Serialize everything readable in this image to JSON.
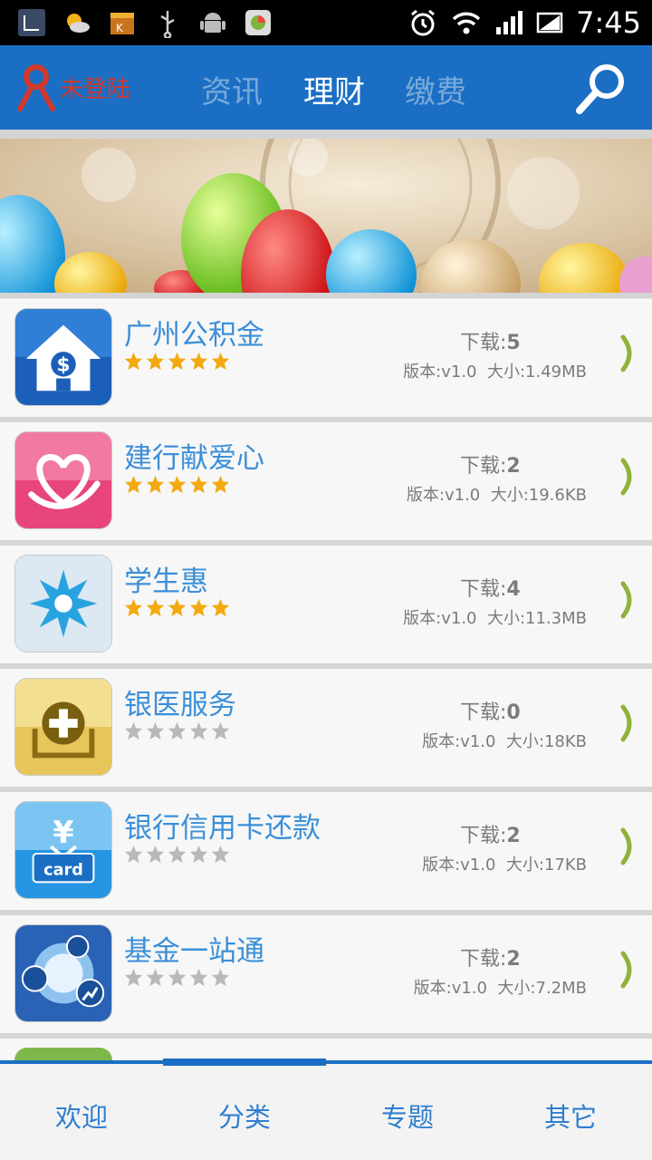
{
  "status_bar": {
    "time": "7:45",
    "left_icons": [
      "screenshot-icon",
      "weather-icon",
      "store-icon",
      "usb-icon",
      "android-icon",
      "app-icon"
    ],
    "right_icons": [
      "alarm-icon",
      "wifi-icon",
      "signal-icon",
      "battery-icon"
    ]
  },
  "header": {
    "login_label": "未登陆",
    "tabs": [
      {
        "label": "资讯",
        "active": false
      },
      {
        "label": "理财",
        "active": true
      },
      {
        "label": "缴费",
        "active": false
      }
    ]
  },
  "apps": [
    {
      "name": "广州公积金",
      "downloads_label": "下载:",
      "downloads": "5",
      "version": "版本:v1.0",
      "size": "大小:1.49MB",
      "rating": 5,
      "icon": "house-dollar-icon"
    },
    {
      "name": "建行献爱心",
      "downloads_label": "下载:",
      "downloads": "2",
      "version": "版本:v1.0",
      "size": "大小:19.6KB",
      "rating": 5,
      "icon": "heart-hand-icon"
    },
    {
      "name": "学生惠",
      "downloads_label": "下载:",
      "downloads": "4",
      "version": "版本:v1.0",
      "size": "大小:11.3MB",
      "rating": 5,
      "icon": "snowflake-icon"
    },
    {
      "name": "银医服务",
      "downloads_label": "下载:",
      "downloads": "0",
      "version": "版本:v1.0",
      "size": "大小:18KB",
      "rating": 0,
      "icon": "medical-plus-icon"
    },
    {
      "name": "银行信用卡还款",
      "downloads_label": "下载:",
      "downloads": "2",
      "version": "版本:v1.0",
      "size": "大小:17KB",
      "rating": 0,
      "icon": "yuan-card-icon"
    },
    {
      "name": "基金一站通",
      "downloads_label": "下载:",
      "downloads": "2",
      "version": "版本:v1.0",
      "size": "大小:7.2MB",
      "rating": 0,
      "icon": "fund-chart-icon"
    }
  ],
  "bottom_nav": [
    {
      "label": "欢迎"
    },
    {
      "label": "分类"
    },
    {
      "label": "专题"
    },
    {
      "label": "其它"
    }
  ],
  "colors": {
    "header_bg": "#1a6fc4",
    "tab_inactive": "#79a9da",
    "app_name": "#3b8fd8",
    "star_filled": "#f3a90f",
    "star_empty": "#b9b9b9",
    "chevron": "#8fb33a",
    "login_text": "#d0392b"
  }
}
